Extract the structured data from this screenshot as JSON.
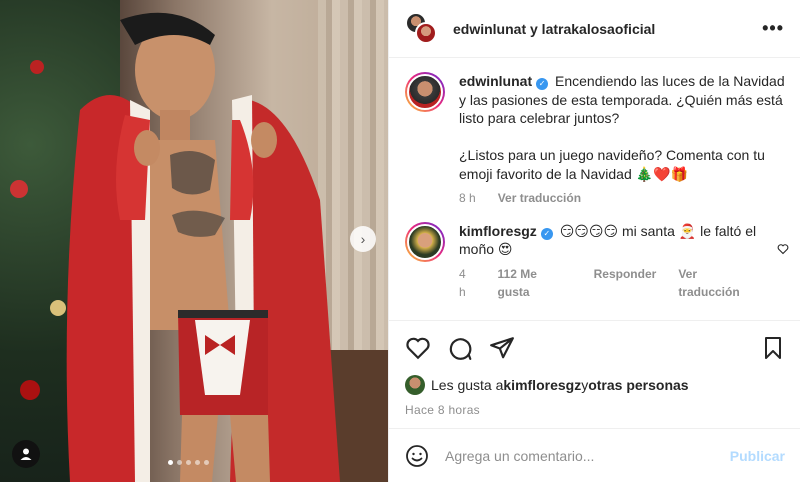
{
  "header": {
    "users": "edwinlunat y latrakalosaoficial",
    "more_icon": "more-horizontal-icon"
  },
  "caption": {
    "username": "edwinlunat",
    "text_line1": "Encendiendo las luces de la Navidad y las pasiones de esta temporada. ¿Quién más está listo para celebrar juntos?",
    "text_line2": "¿Listos para un juego navideño? Comenta con tu emoji favorito de la Navidad 🎄❤️🎁",
    "time": "8 h",
    "translate": "Ver traducción"
  },
  "comment": {
    "username": "kimfloresgz",
    "text": "😏😏😏😏 mi santa 🎅 le faltó el moño 😍",
    "time": "4 h",
    "likes": "112 Me gusta",
    "reply": "Responder",
    "translate": "Ver traducción"
  },
  "likes": {
    "prefix": "Les gusta a ",
    "user": "kimfloresgz",
    "mid": " y ",
    "others": "otras personas"
  },
  "post_time": "Hace 8 horas",
  "composer": {
    "placeholder": "Agrega un comentario...",
    "publish": "Publicar"
  },
  "carousel": {
    "slides": 5,
    "active": 1
  },
  "colors": {
    "verified": "#3897f0",
    "publish_disabled": "#b3dbff",
    "meta": "#8e8e8e"
  }
}
